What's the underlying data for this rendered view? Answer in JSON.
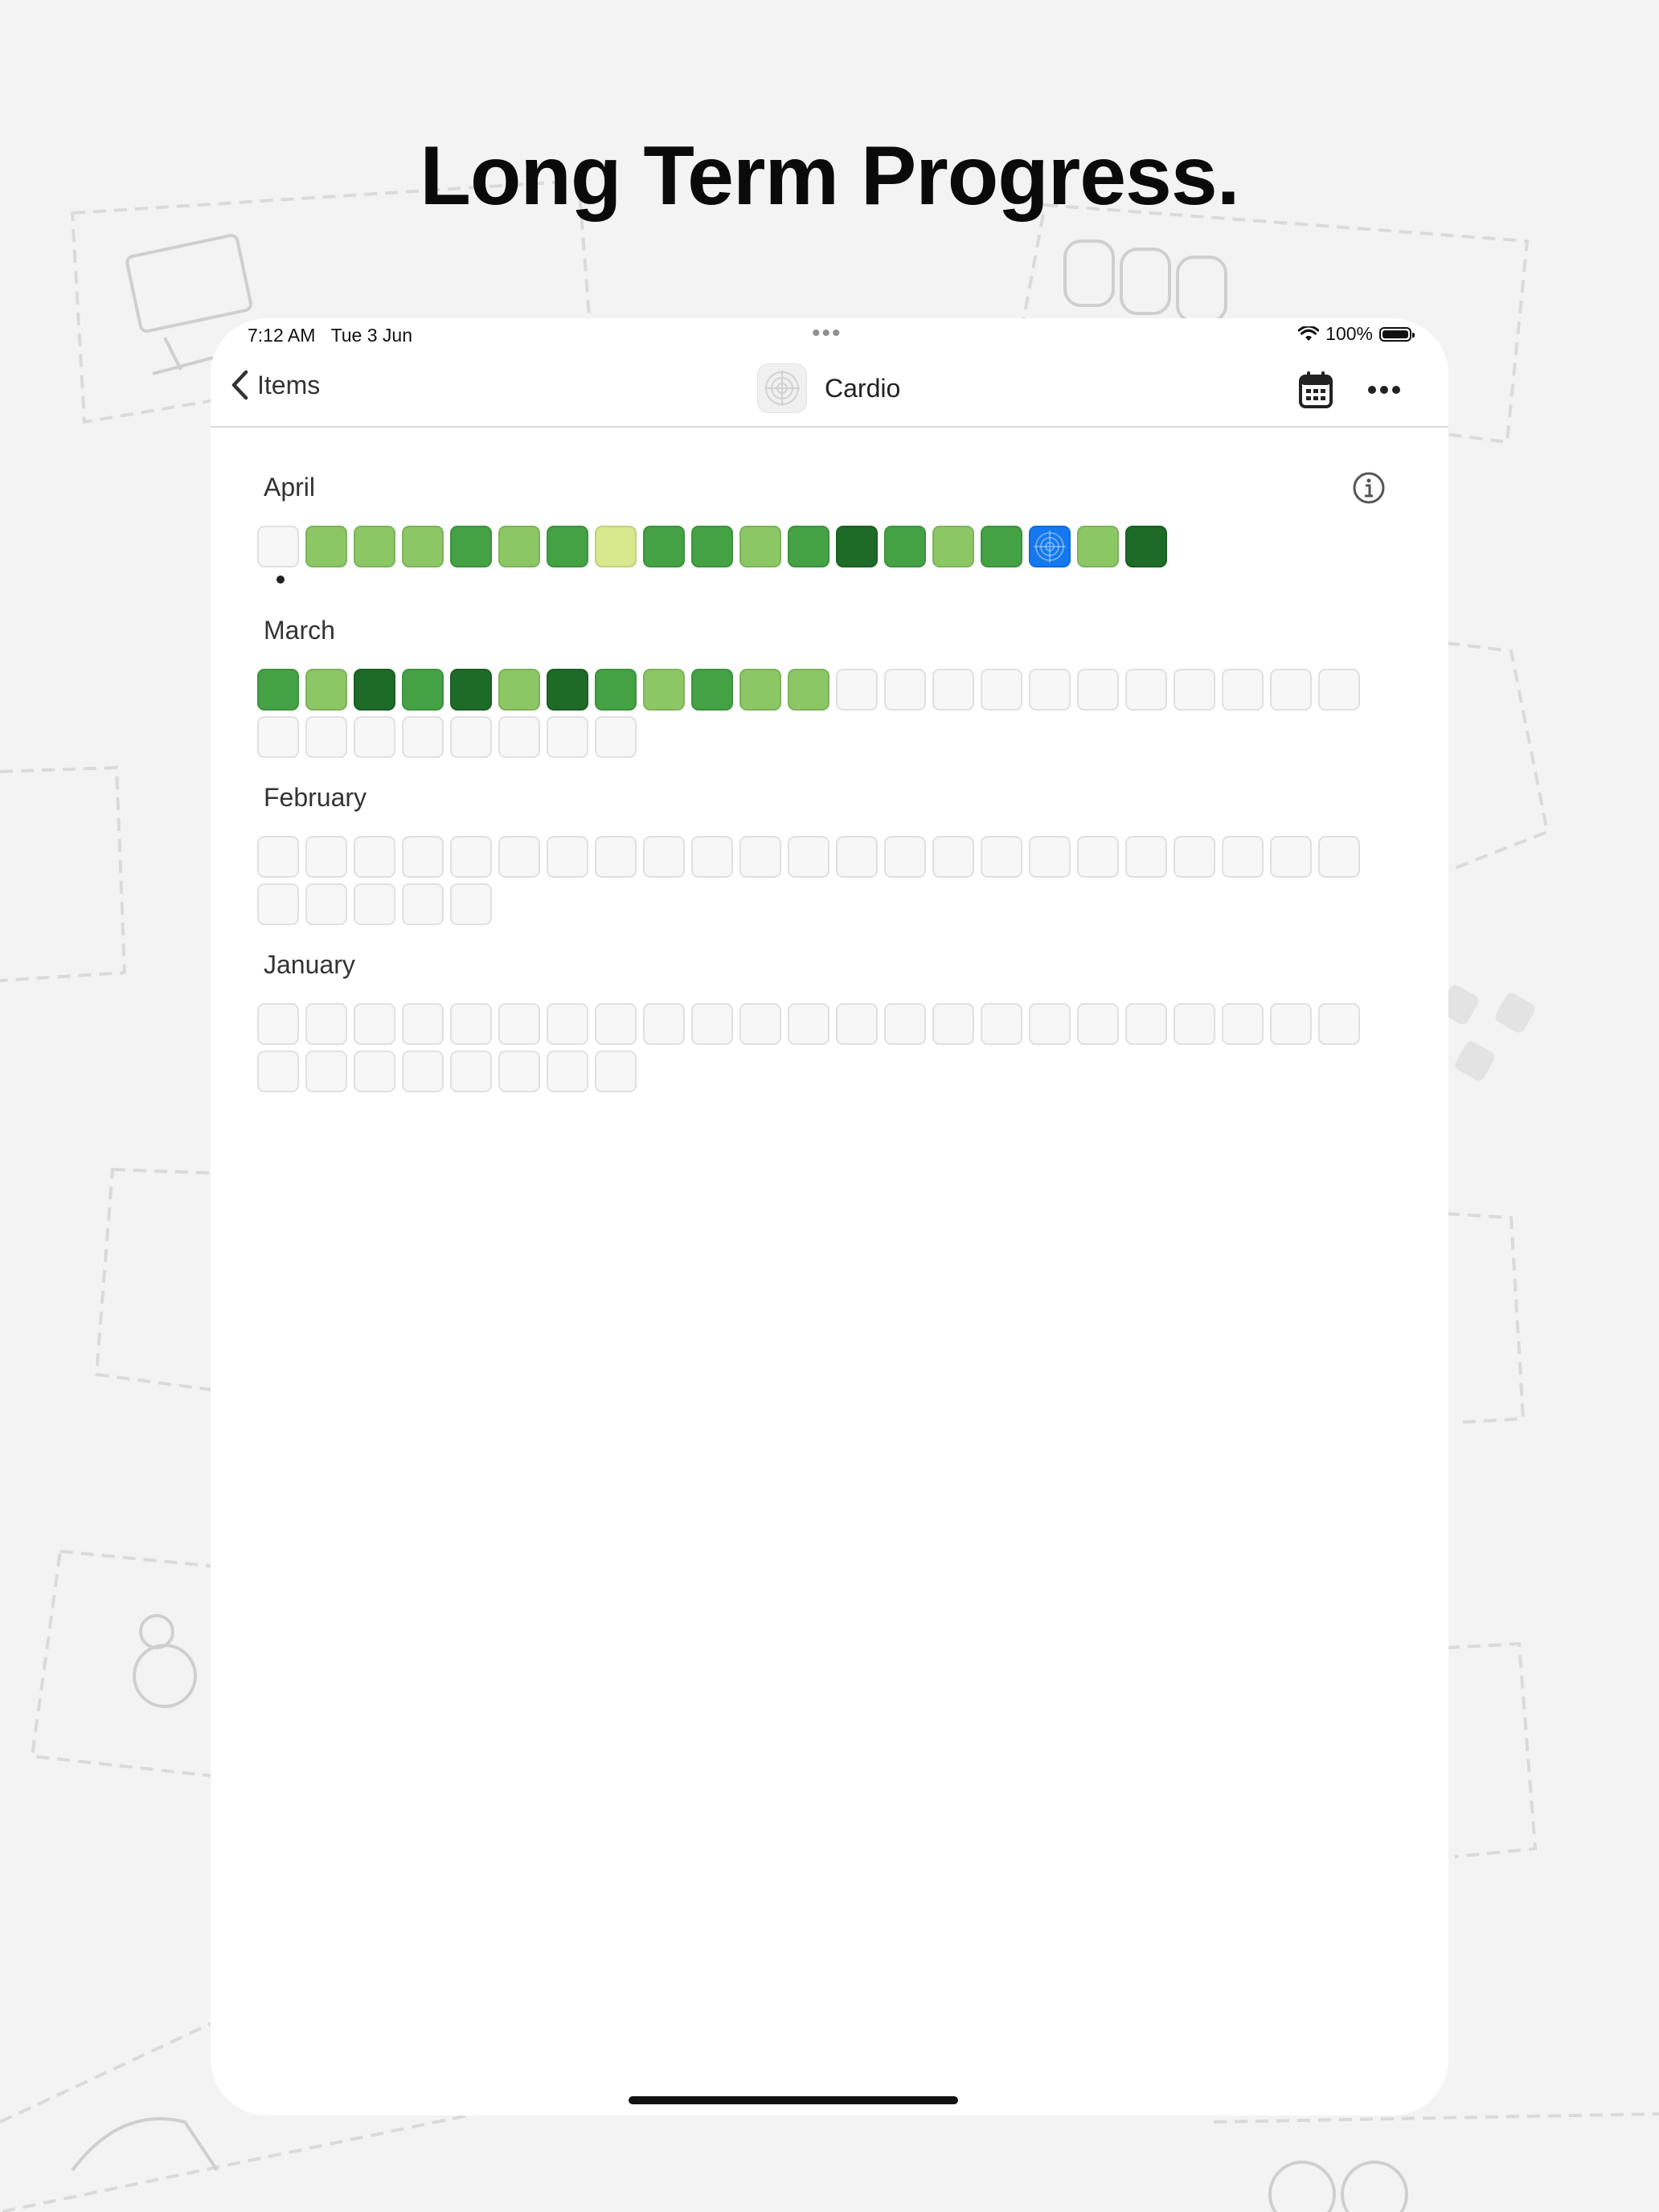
{
  "headline": "Long Term Progress.",
  "status_bar": {
    "time": "7:12 AM",
    "date": "Tue 3 Jun",
    "battery": "100%"
  },
  "nav": {
    "back_label": "Items",
    "title": "Cardio"
  },
  "icons": {
    "back": "chevron-left-icon",
    "app": "target-icon",
    "calendar": "calendar-icon",
    "more": "ellipsis-icon",
    "info": "info-icon",
    "wifi": "wifi-icon",
    "battery": "battery-icon"
  },
  "colors": {
    "empty": "#f7f7f8",
    "lightest": "#d8e88c",
    "light": "#8cc765",
    "medium": "#44a244",
    "dark": "#1e6a27",
    "highlight": "#1479f0"
  },
  "months": [
    {
      "label": "April",
      "days": [
        "empty",
        "light",
        "light",
        "light",
        "medium",
        "light",
        "medium",
        "lightest",
        "medium",
        "medium",
        "light",
        "medium",
        "dark",
        "medium",
        "light",
        "medium",
        "highlight",
        "light",
        "dark"
      ]
    },
    {
      "label": "March",
      "days": [
        "medium",
        "light",
        "dark",
        "medium",
        "dark",
        "light",
        "dark",
        "medium",
        "light",
        "medium",
        "light",
        "light",
        "empty",
        "empty",
        "empty",
        "empty",
        "empty",
        "empty",
        "empty",
        "empty",
        "empty",
        "empty",
        "empty",
        "empty",
        "empty",
        "empty",
        "empty",
        "empty",
        "empty",
        "empty",
        "empty"
      ]
    },
    {
      "label": "February",
      "days": [
        "empty",
        "empty",
        "empty",
        "empty",
        "empty",
        "empty",
        "empty",
        "empty",
        "empty",
        "empty",
        "empty",
        "empty",
        "empty",
        "empty",
        "empty",
        "empty",
        "empty",
        "empty",
        "empty",
        "empty",
        "empty",
        "empty",
        "empty",
        "empty",
        "empty",
        "empty",
        "empty",
        "empty"
      ]
    },
    {
      "label": "January",
      "days": [
        "empty",
        "empty",
        "empty",
        "empty",
        "empty",
        "empty",
        "empty",
        "empty",
        "empty",
        "empty",
        "empty",
        "empty",
        "empty",
        "empty",
        "empty",
        "empty",
        "empty",
        "empty",
        "empty",
        "empty",
        "empty",
        "empty",
        "empty",
        "empty",
        "empty",
        "empty",
        "empty",
        "empty",
        "empty",
        "empty",
        "empty"
      ]
    }
  ]
}
